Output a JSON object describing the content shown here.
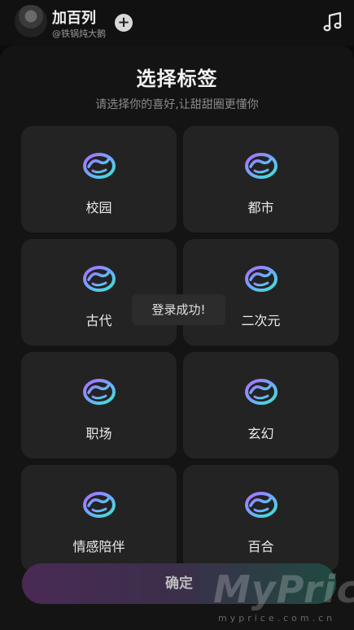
{
  "header": {
    "user_name": "加百列",
    "user_handle": "@铁锅炖大鹅",
    "follow_symbol": "+",
    "music_icon": "music-note-icon"
  },
  "sheet": {
    "title": "选择标签",
    "subtitle": "请选择你的喜好,让甜甜圈更懂你",
    "tags": [
      {
        "label": "校园",
        "icon": "donut-icon"
      },
      {
        "label": "都市",
        "icon": "donut-icon"
      },
      {
        "label": "古代",
        "icon": "donut-icon"
      },
      {
        "label": "二次元",
        "icon": "donut-icon"
      },
      {
        "label": "职场",
        "icon": "donut-icon"
      },
      {
        "label": "玄幻",
        "icon": "donut-icon"
      },
      {
        "label": "情感陪伴",
        "icon": "donut-icon"
      },
      {
        "label": "百合",
        "icon": "donut-icon"
      }
    ],
    "confirm_label": "确定"
  },
  "toast": {
    "message": "登录成功!"
  },
  "watermark": {
    "brand": "MyPrice",
    "domain": "myprice.com.cn"
  },
  "colors": {
    "background": "#141414",
    "card": "#232323",
    "icon_gradient_start": "#b06cff",
    "icon_gradient_end": "#3ee6d0",
    "confirm_gradient_start": "#4a2a55",
    "confirm_gradient_end": "#1f4a40"
  }
}
